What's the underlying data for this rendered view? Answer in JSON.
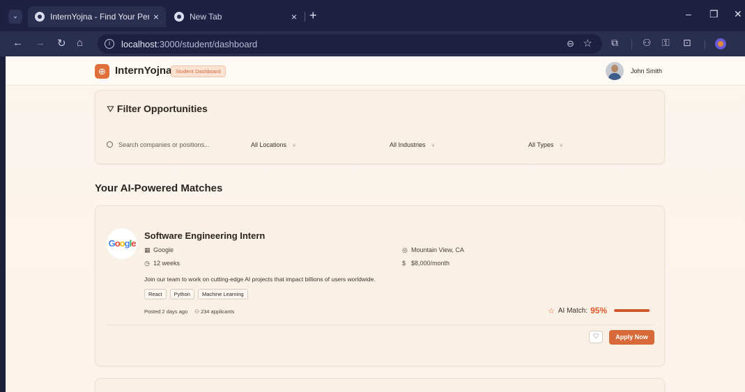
{
  "browser": {
    "tabs": [
      {
        "title": "InternYojna - Find Your Perfect I",
        "active": true
      },
      {
        "title": "New Tab",
        "active": false
      }
    ],
    "url_host": "localhost",
    "url_path": ":3000/student/dashboard",
    "tab_close": "×",
    "new_tab": "+"
  },
  "header": {
    "brand": "InternYojna",
    "badge": "Student Dashboard",
    "user_name": "John Smith"
  },
  "filters": {
    "title": "Filter Opportunities",
    "search_placeholder": "Search companies or positions...",
    "location": "All Locations",
    "industry": "All Industries",
    "type": "All Types"
  },
  "section_title": "Your AI-Powered Matches",
  "jobs": [
    {
      "company_logo_text": "Google",
      "title": "Software Engineering Intern",
      "company": "Google",
      "location": "Mountain View, CA",
      "duration": "12 weeks",
      "stipend": "$8,000/month",
      "description": "Join our team to work on cutting-edge AI projects that impact billions of users worldwide.",
      "tags": [
        "React",
        "Python",
        "Machine Learning"
      ],
      "posted": "Posted 2 days ago",
      "applicants": "234 applicants",
      "match_label": "AI Match:",
      "match_value": "95%",
      "match_fraction": 0.95,
      "apply_label": "Apply Now"
    }
  ],
  "colors": {
    "accent": "#d8693a",
    "brand": "#e06f3b",
    "page_bg": "#fbf5ee"
  }
}
